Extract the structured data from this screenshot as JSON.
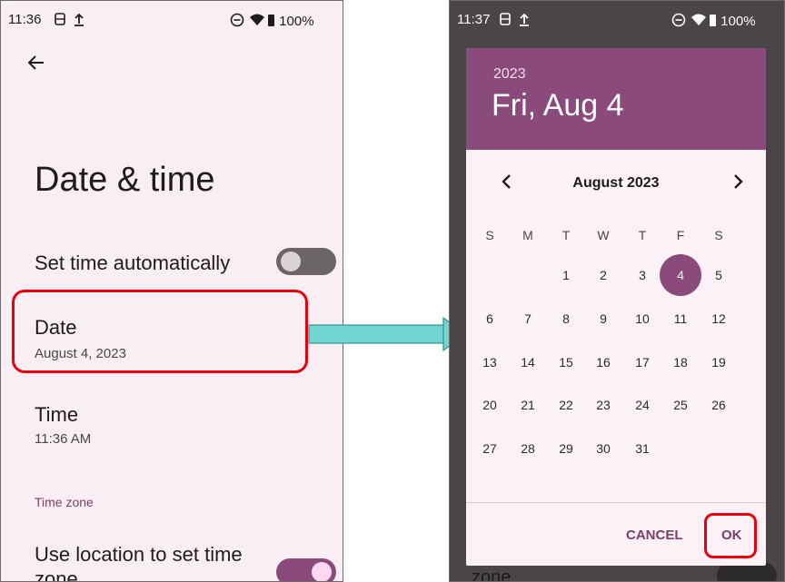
{
  "left": {
    "status": {
      "time": "11:36",
      "battery": "100%"
    },
    "title": "Date & time",
    "set_time_auto": {
      "label": "Set time automatically",
      "enabled": false
    },
    "date": {
      "title": "Date",
      "value": "August 4, 2023"
    },
    "time": {
      "title": "Time",
      "value": "11:36 AM"
    },
    "section_time_zone": "Time zone",
    "use_location": {
      "label_line1": "Use location to set time",
      "label_line2": "zone",
      "enabled": true
    }
  },
  "right": {
    "status": {
      "time": "11:37",
      "battery": "100%"
    },
    "dialog": {
      "year": "2023",
      "selected_date": "Fri, Aug 4",
      "month_label": "August 2023",
      "days_of_week": [
        "S",
        "M",
        "T",
        "W",
        "T",
        "F",
        "S"
      ],
      "weeks": [
        [
          "",
          "",
          "1",
          "2",
          "3",
          "4",
          "5"
        ],
        [
          "6",
          "7",
          "8",
          "9",
          "10",
          "11",
          "12"
        ],
        [
          "13",
          "14",
          "15",
          "16",
          "17",
          "18",
          "19"
        ],
        [
          "20",
          "21",
          "22",
          "23",
          "24",
          "25",
          "26"
        ],
        [
          "27",
          "28",
          "29",
          "30",
          "31",
          "",
          ""
        ]
      ],
      "selected_day": "4",
      "cancel_label": "CANCEL",
      "ok_label": "OK"
    },
    "bottom_peek_text": "zone"
  },
  "colors": {
    "accent": "#8a4b7c",
    "highlight": "#e8000d",
    "arrow": "#6fd6d2"
  }
}
